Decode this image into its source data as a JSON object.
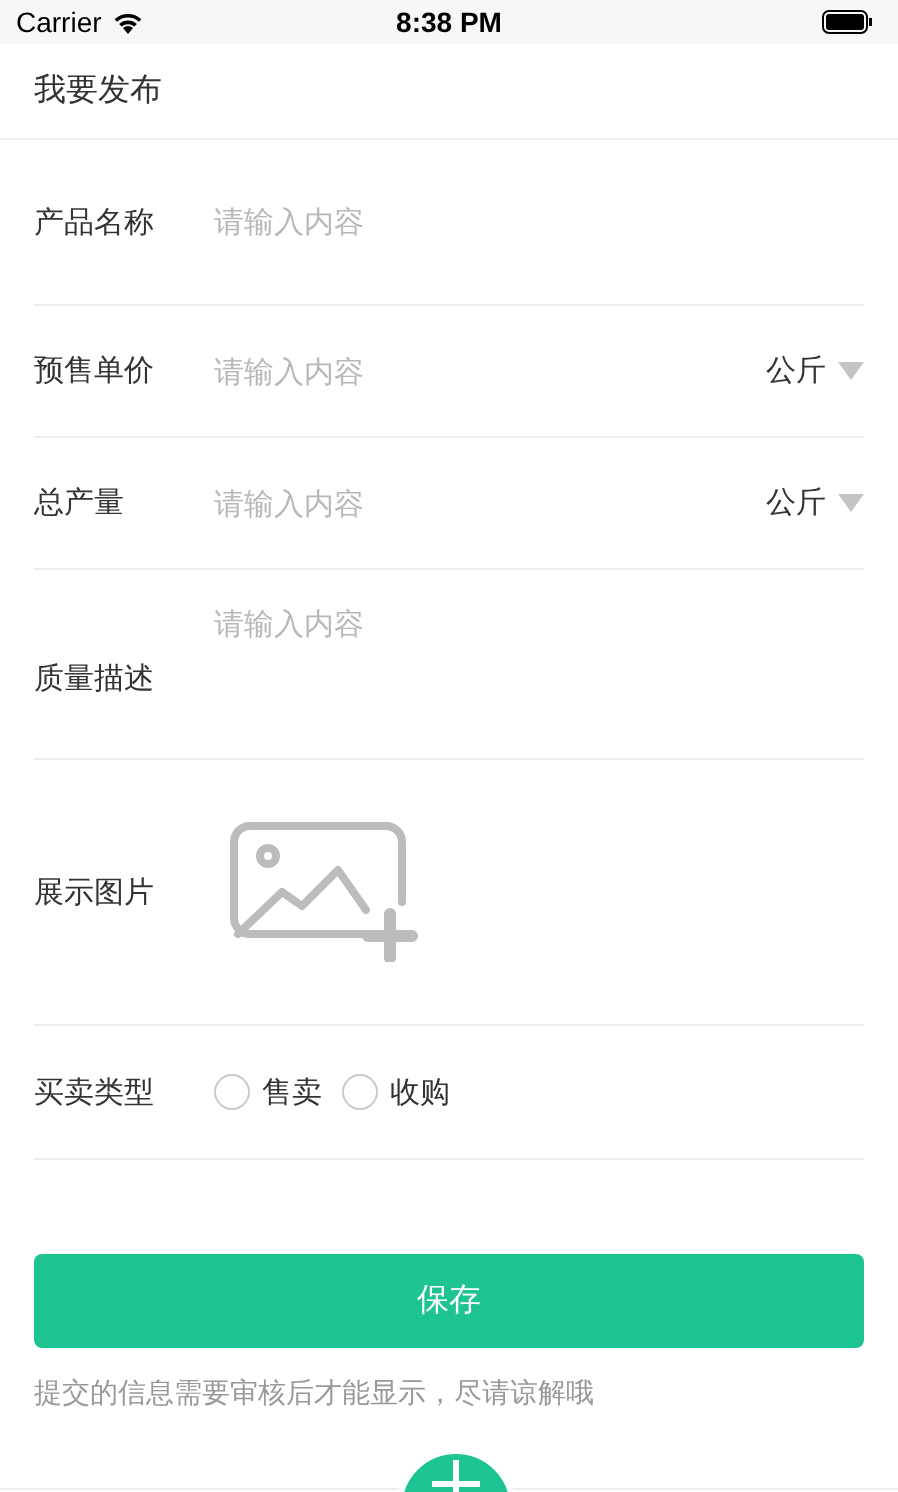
{
  "status_bar": {
    "carrier": "Carrier",
    "time": "8:38 PM"
  },
  "header": {
    "title": "我要发布"
  },
  "form": [
    {
      "kind": "text",
      "label": "产品名称",
      "placeholder": "请输入内容"
    },
    {
      "kind": "text",
      "label": "预售单价",
      "placeholder": "请输入内容",
      "unit": "公斤"
    },
    {
      "kind": "text",
      "label": "总产量",
      "placeholder": "请输入内容",
      "unit": "公斤"
    },
    {
      "kind": "textarea",
      "label": "质量描述",
      "placeholder": "请输入内容"
    },
    {
      "kind": "image",
      "label": "展示图片"
    },
    {
      "kind": "radio",
      "label": "买卖类型",
      "options": [
        {
          "label": "售卖",
          "selected": false
        },
        {
          "label": "收购",
          "selected": false
        }
      ]
    }
  ],
  "save_button": "保存",
  "note": "提交的信息需要审核后才能显示，尽请谅解哦"
}
